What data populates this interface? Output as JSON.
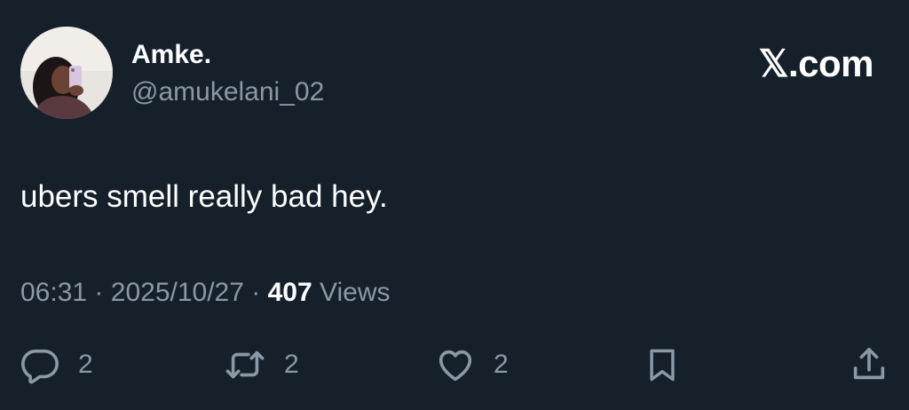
{
  "author": {
    "display_name": "Amke.",
    "handle": "@amukelani_02"
  },
  "brand": {
    "label": "𝕏.com"
  },
  "tweet": {
    "text": "ubers smell really bad hey."
  },
  "meta": {
    "time": "06:31",
    "separator": "·",
    "date": "2025/10/27",
    "views_count": "407",
    "views_label": "Views"
  },
  "actions": {
    "reply_count": "2",
    "repost_count": "2",
    "like_count": "2"
  },
  "icons": {
    "reply": "speech-bubble-icon",
    "repost": "repost-arrows-icon",
    "like": "heart-icon",
    "bookmark": "bookmark-icon",
    "share": "share-upload-icon"
  },
  "colors": {
    "background": "#15202b",
    "primary_text": "#ffffff",
    "secondary_text": "#8b98a5"
  }
}
